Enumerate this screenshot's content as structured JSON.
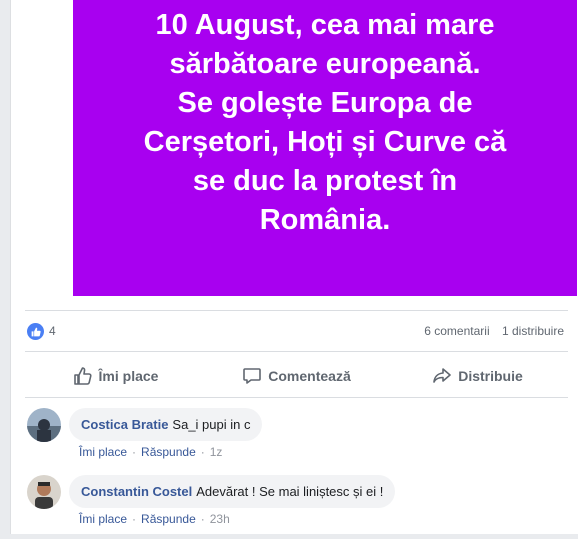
{
  "post": {
    "image_text": [
      "10 August, cea mai mare",
      "sărbătoare europeană.",
      "Se golește Europa de",
      "Cerșetori, Hoți și Curve că",
      "se duc la protest în",
      "România."
    ],
    "image_bg": "#a800f0"
  },
  "stats": {
    "reactions": "4",
    "comments": "6 comentarii",
    "shares": "1 distribuire"
  },
  "actions": {
    "like": "Îmi place",
    "comment": "Comentează",
    "share": "Distribuie"
  },
  "comments": [
    {
      "author": "Costica Bratie",
      "text": "Sa_i pupi in c",
      "like": "Îmi place",
      "reply": "Răspunde",
      "time": "1z"
    },
    {
      "author": "Constantin Costel",
      "text": "Adevărat ! Se mai liniștesc și ei !",
      "like": "Îmi place",
      "reply": "Răspunde",
      "time": "23h"
    }
  ],
  "colors": {
    "accent": "#385898",
    "like_badge": "#4a7ff4"
  },
  "icons": [
    "thumbs-up-icon",
    "comment-icon",
    "share-icon"
  ]
}
